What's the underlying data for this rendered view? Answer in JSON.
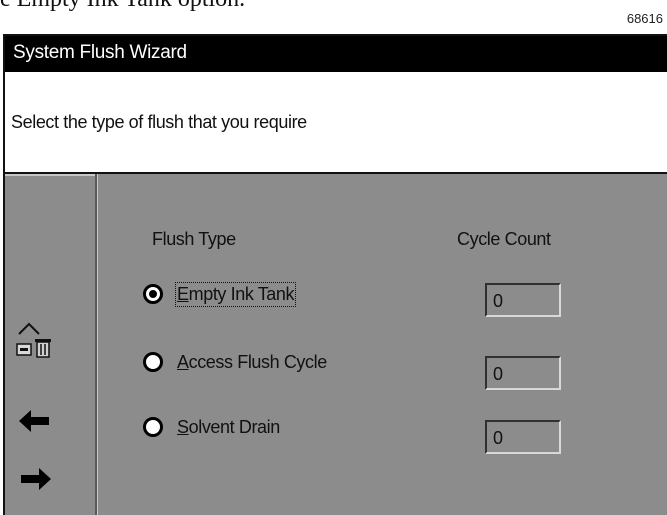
{
  "document": {
    "top_text": "e Empty Ink Tank option.",
    "figure_number": "68616"
  },
  "window": {
    "title": "System Flush Wizard",
    "instruction": "Select the type of flush that you require"
  },
  "sidebar": {
    "tools": [
      {
        "icon": "home-trash-icon"
      },
      {
        "icon": "arrow-left-icon"
      },
      {
        "icon": "arrow-right-icon"
      }
    ]
  },
  "table": {
    "header_type": "Flush Type",
    "header_count": "Cycle Count",
    "options": [
      {
        "label_ul": "E",
        "label_rest": "mpty Ink Tank",
        "selected": true,
        "count": "0"
      },
      {
        "label_ul": "A",
        "label_rest": "ccess Flush Cycle",
        "selected": false,
        "count": "0"
      },
      {
        "label_ul": "S",
        "label_rest": "olvent Drain",
        "selected": false,
        "count": "0"
      }
    ]
  }
}
